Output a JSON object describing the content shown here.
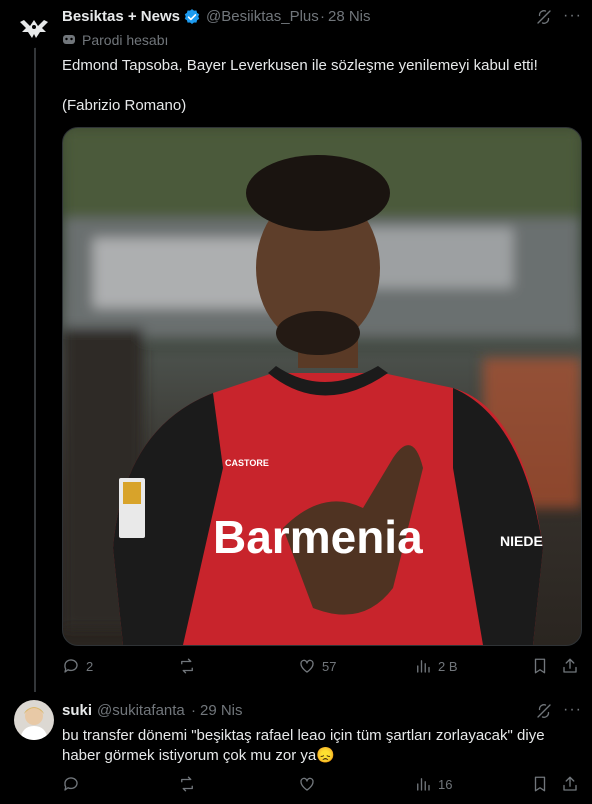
{
  "main_tweet": {
    "author_name": "Besiktas + News",
    "handle": "@Besiiktas_Plus",
    "time": "28 Nis",
    "parody_label": "Parodi hesabı",
    "text_line1": "Edmond Tapsoba, Bayer Leverkusen ile sözleşme yenilemeyi kabul etti!",
    "text_line2": "(Fabrizio Romano)",
    "image_alt": "Edmond Tapsoba",
    "shirt_sponsor": "Barmenia",
    "shirt_brand": "CASTORE",
    "shirt_side": "NIEDE",
    "stats": {
      "replies": "2",
      "reposts": "",
      "likes": "57",
      "views": "2 B"
    }
  },
  "reply_tweet": {
    "author_name": "suki",
    "handle": "@sukitafanta",
    "time": "29 Nis",
    "text_line1": "bu transfer dönemi \"beşiktaş rafael leao için tüm şartları zorlayacak\" diye",
    "text_line2": "haber görmek istiyorum çok mu zor ya😞",
    "stats": {
      "views": "16"
    }
  },
  "colors": {
    "background": "#000000",
    "text": "#e7e9ea",
    "muted": "#71767b",
    "verified": "#1d9bf0"
  },
  "icons": [
    "reply-icon",
    "repost-icon",
    "like-icon",
    "views-icon",
    "bookmark-icon",
    "share-icon",
    "grok-icon",
    "more-icon",
    "verified-icon",
    "parody-mask-icon"
  ]
}
